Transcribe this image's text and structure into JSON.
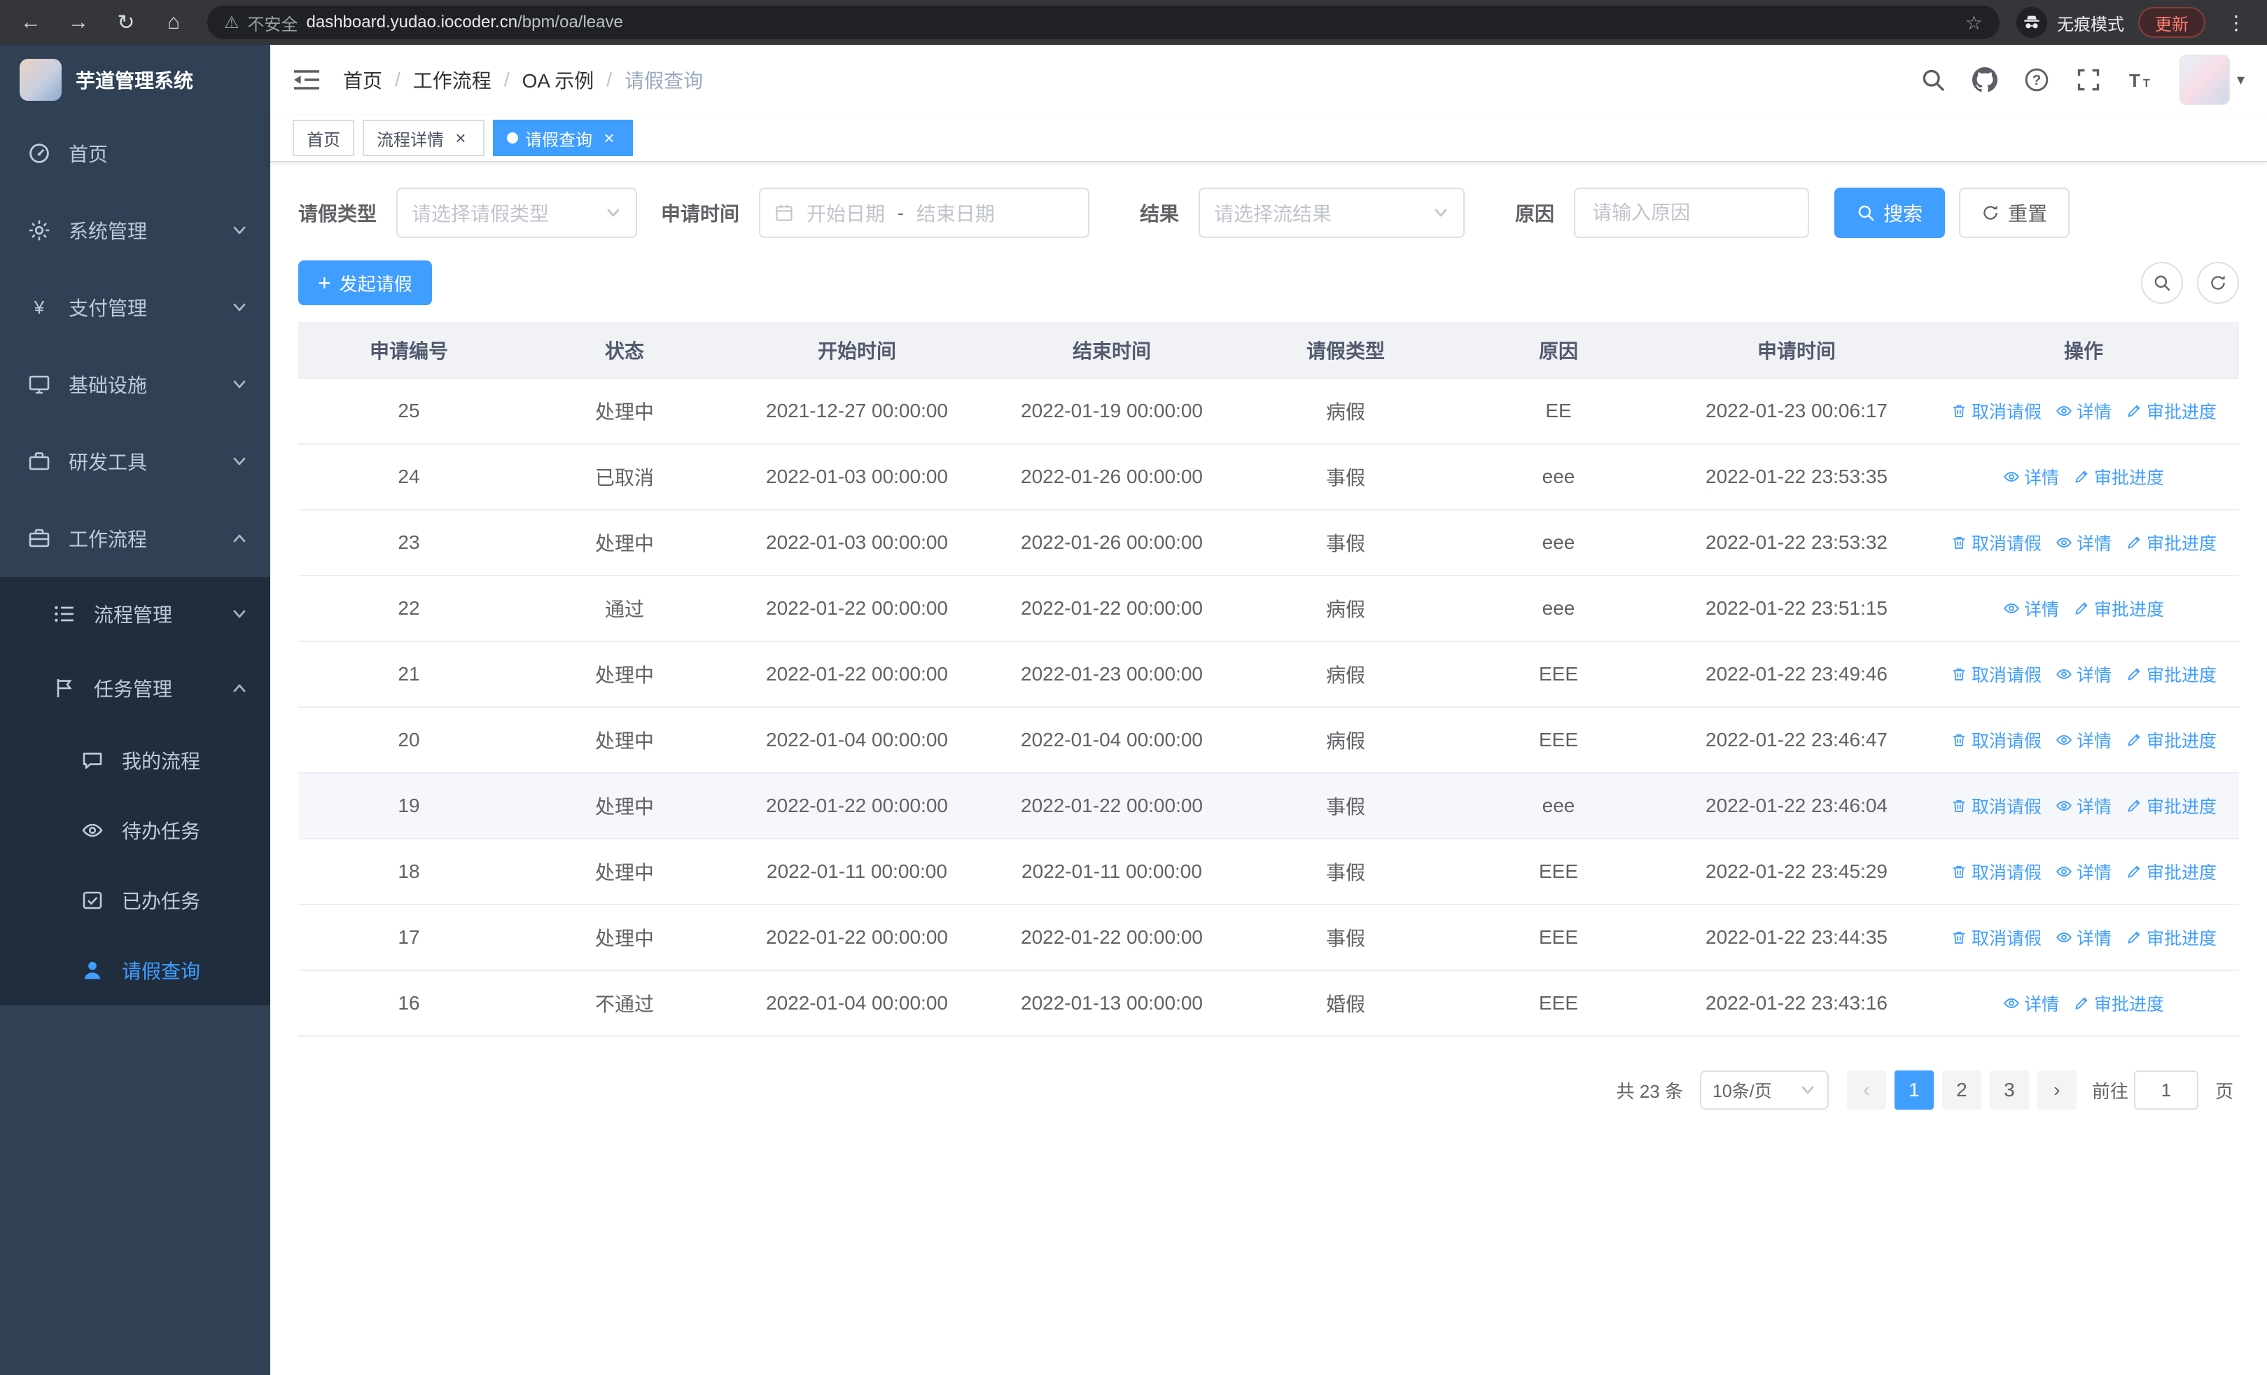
{
  "colors": {
    "primary": "#409EFF",
    "sidebar_bg": "#304156",
    "submenu_bg": "#1f2d3d",
    "sidebar_text": "#bfcbd9",
    "danger": "#ff7b72"
  },
  "browser": {
    "security_warning": "不安全",
    "url_domain": "dashboard.yudao.iocoder.cn",
    "url_path": "/bpm/oa/leave",
    "incognito_label": "无痕模式",
    "update_button": "更新"
  },
  "sidebar": {
    "app_title": "芋道管理系统",
    "menu": [
      {
        "id": "home",
        "label": "首页",
        "icon": "dashboard",
        "level": 1
      },
      {
        "id": "system",
        "label": "系统管理",
        "icon": "gear",
        "level": 1,
        "arrow": "down"
      },
      {
        "id": "payment",
        "label": "支付管理",
        "icon": "yen",
        "level": 1,
        "arrow": "down"
      },
      {
        "id": "infrastructure",
        "label": "基础设施",
        "icon": "monitor",
        "level": 1,
        "arrow": "down"
      },
      {
        "id": "devtools",
        "label": "研发工具",
        "icon": "toolbox",
        "level": 1,
        "arrow": "down"
      },
      {
        "id": "workflow",
        "label": "工作流程",
        "icon": "workflow",
        "level": 1,
        "arrow": "up"
      },
      {
        "id": "process-manage",
        "label": "流程管理",
        "icon": "process-list",
        "level": 2,
        "arrow": "down",
        "sub": true
      },
      {
        "id": "task-manage",
        "label": "任务管理",
        "icon": "task-flag",
        "level": 2,
        "arrow": "up",
        "sub": true
      },
      {
        "id": "my-process",
        "label": "我的流程",
        "icon": "chat-bubble",
        "level": 3,
        "sub": true
      },
      {
        "id": "todo-tasks",
        "label": "待办任务",
        "icon": "eye",
        "level": 3,
        "sub": true
      },
      {
        "id": "done-tasks",
        "label": "已办任务",
        "icon": "done-tasks",
        "level": 3,
        "sub": true
      },
      {
        "id": "leave-query",
        "label": "请假查询",
        "icon": "user",
        "level": 3,
        "sub": true,
        "active": true
      }
    ]
  },
  "navbar": {
    "separator": "/",
    "breadcrumb": [
      {
        "label": "首页"
      },
      {
        "label": "工作流程"
      },
      {
        "label": "OA 示例"
      },
      {
        "label": "请假查询",
        "current": true
      }
    ]
  },
  "tabs": [
    {
      "id": "home",
      "label": "首页"
    },
    {
      "id": "process-detail",
      "label": "流程详情",
      "closable": true
    },
    {
      "id": "leave-query",
      "label": "请假查询",
      "closable": true,
      "active": true
    }
  ],
  "filters": {
    "leave_type": {
      "label": "请假类型",
      "placeholder": "请选择请假类型"
    },
    "apply_time": {
      "label": "申请时间",
      "start_placeholder": "开始日期",
      "separator": "-",
      "end_placeholder": "结束日期"
    },
    "result": {
      "label": "结果",
      "placeholder": "请选择流结果"
    },
    "reason": {
      "label": "原因",
      "placeholder": "请输入原因"
    },
    "search_button": "搜索",
    "reset_button": "重置"
  },
  "toolbar": {
    "create_button": "发起请假"
  },
  "table": {
    "columns": [
      "申请编号",
      "状态",
      "开始时间",
      "结束时间",
      "请假类型",
      "原因",
      "申请时间",
      "操作"
    ],
    "action_labels": {
      "cancel": "取消请假",
      "detail": "详情",
      "progress": "审批进度"
    },
    "rows": [
      {
        "id": "25",
        "status": "处理中",
        "start_time": "2021-12-27 00:00:00",
        "end_time": "2022-01-19 00:00:00",
        "leave_type": "病假",
        "reason": "EE",
        "apply_time": "2022-01-23 00:06:17",
        "cancellable": true
      },
      {
        "id": "24",
        "status": "已取消",
        "start_time": "2022-01-03 00:00:00",
        "end_time": "2022-01-26 00:00:00",
        "leave_type": "事假",
        "reason": "eee",
        "apply_time": "2022-01-22 23:53:35",
        "cancellable": false
      },
      {
        "id": "23",
        "status": "处理中",
        "start_time": "2022-01-03 00:00:00",
        "end_time": "2022-01-26 00:00:00",
        "leave_type": "事假",
        "reason": "eee",
        "apply_time": "2022-01-22 23:53:32",
        "cancellable": true
      },
      {
        "id": "22",
        "status": "通过",
        "start_time": "2022-01-22 00:00:00",
        "end_time": "2022-01-22 00:00:00",
        "leave_type": "病假",
        "reason": "eee",
        "apply_time": "2022-01-22 23:51:15",
        "cancellable": false
      },
      {
        "id": "21",
        "status": "处理中",
        "start_time": "2022-01-22 00:00:00",
        "end_time": "2022-01-23 00:00:00",
        "leave_type": "病假",
        "reason": "EEE",
        "apply_time": "2022-01-22 23:49:46",
        "cancellable": true
      },
      {
        "id": "20",
        "status": "处理中",
        "start_time": "2022-01-04 00:00:00",
        "end_time": "2022-01-04 00:00:00",
        "leave_type": "病假",
        "reason": "EEE",
        "apply_time": "2022-01-22 23:46:47",
        "cancellable": true
      },
      {
        "id": "19",
        "status": "处理中",
        "start_time": "2022-01-22 00:00:00",
        "end_time": "2022-01-22 00:00:00",
        "leave_type": "事假",
        "reason": "eee",
        "apply_time": "2022-01-22 23:46:04",
        "cancellable": true,
        "highlighted": true
      },
      {
        "id": "18",
        "status": "处理中",
        "start_time": "2022-01-11 00:00:00",
        "end_time": "2022-01-11 00:00:00",
        "leave_type": "事假",
        "reason": "EEE",
        "apply_time": "2022-01-22 23:45:29",
        "cancellable": true
      },
      {
        "id": "17",
        "status": "处理中",
        "start_time": "2022-01-22 00:00:00",
        "end_time": "2022-01-22 00:00:00",
        "leave_type": "事假",
        "reason": "EEE",
        "apply_time": "2022-01-22 23:44:35",
        "cancellable": true
      },
      {
        "id": "16",
        "status": "不通过",
        "start_time": "2022-01-04 00:00:00",
        "end_time": "2022-01-13 00:00:00",
        "leave_type": "婚假",
        "reason": "EEE",
        "apply_time": "2022-01-22 23:43:16",
        "cancellable": false
      }
    ]
  },
  "pagination": {
    "total_text": "共 23 条",
    "page_size": "10条/页",
    "pages": [
      "1",
      "2",
      "3"
    ],
    "active_page": "1",
    "goto_label": "前往",
    "goto_value": "1",
    "goto_unit": "页"
  }
}
